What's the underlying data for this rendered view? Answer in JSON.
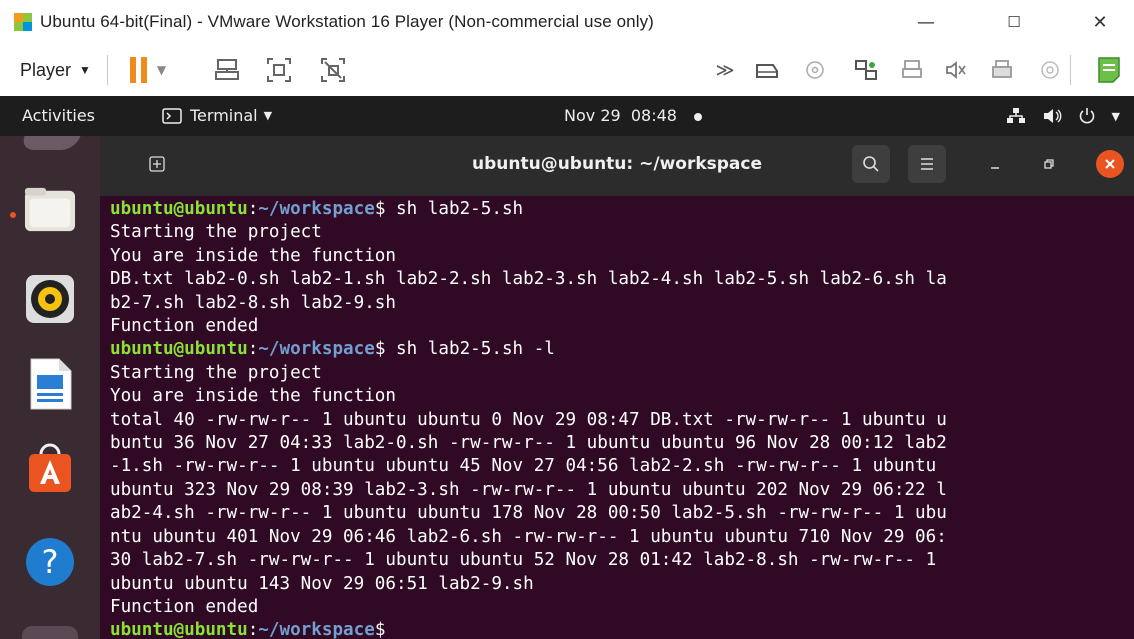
{
  "vm": {
    "title": "Ubuntu 64-bit(Final) - VMware Workstation 16 Player (Non-commercial use only)",
    "player_menu": "Player",
    "window_controls": [
      "—",
      "☐",
      "✕"
    ]
  },
  "topbar": {
    "activities": "Activities",
    "app_menu": "Terminal",
    "clock": "Nov 29  08:48"
  },
  "terminal": {
    "title": "ubuntu@ubuntu: ~/workspace",
    "prompt_user": "ubuntu@ubuntu",
    "prompt_path": "~/workspace",
    "lines": [
      {
        "type": "prompt",
        "cmd": " sh lab2-5.sh"
      },
      {
        "type": "out",
        "text": "Starting the project"
      },
      {
        "type": "out",
        "text": "You are inside the function"
      },
      {
        "type": "out",
        "text": "DB.txt lab2-0.sh lab2-1.sh lab2-2.sh lab2-3.sh lab2-4.sh lab2-5.sh lab2-6.sh la"
      },
      {
        "type": "out",
        "text": "b2-7.sh lab2-8.sh lab2-9.sh"
      },
      {
        "type": "out",
        "text": "Function ended"
      },
      {
        "type": "prompt",
        "cmd": " sh lab2-5.sh -l"
      },
      {
        "type": "out",
        "text": "Starting the project"
      },
      {
        "type": "out",
        "text": "You are inside the function"
      },
      {
        "type": "out",
        "text": "total 40 -rw-rw-r-- 1 ubuntu ubuntu 0 Nov 29 08:47 DB.txt -rw-rw-r-- 1 ubuntu u"
      },
      {
        "type": "out",
        "text": "buntu 36 Nov 27 04:33 lab2-0.sh -rw-rw-r-- 1 ubuntu ubuntu 96 Nov 28 00:12 lab2"
      },
      {
        "type": "out",
        "text": "-1.sh -rw-rw-r-- 1 ubuntu ubuntu 45 Nov 27 04:56 lab2-2.sh -rw-rw-r-- 1 ubuntu"
      },
      {
        "type": "out",
        "text": "ubuntu 323 Nov 29 08:39 lab2-3.sh -rw-rw-r-- 1 ubuntu ubuntu 202 Nov 29 06:22 l"
      },
      {
        "type": "out",
        "text": "ab2-4.sh -rw-rw-r-- 1 ubuntu ubuntu 178 Nov 28 00:50 lab2-5.sh -rw-rw-r-- 1 ubu"
      },
      {
        "type": "out",
        "text": "ntu ubuntu 401 Nov 29 06:46 lab2-6.sh -rw-rw-r-- 1 ubuntu ubuntu 710 Nov 29 06:"
      },
      {
        "type": "out",
        "text": "30 lab2-7.sh -rw-rw-r-- 1 ubuntu ubuntu 52 Nov 28 01:42 lab2-8.sh -rw-rw-r-- 1"
      },
      {
        "type": "out",
        "text": "ubuntu ubuntu 143 Nov 29 06:51 lab2-9.sh"
      },
      {
        "type": "out",
        "text": "Function ended"
      },
      {
        "type": "prompt",
        "cmd": ""
      }
    ]
  },
  "dock": {
    "items": [
      "files-icon",
      "rhythmbox-icon",
      "libreoffice-writer-icon",
      "software-center-icon",
      "help-icon"
    ]
  },
  "colors": {
    "terminal_bg": "#300a24",
    "prompt_user": "#8ae234",
    "prompt_path": "#729fcf",
    "pause_orange": "#f08a1c",
    "close_orange": "#e95420"
  }
}
